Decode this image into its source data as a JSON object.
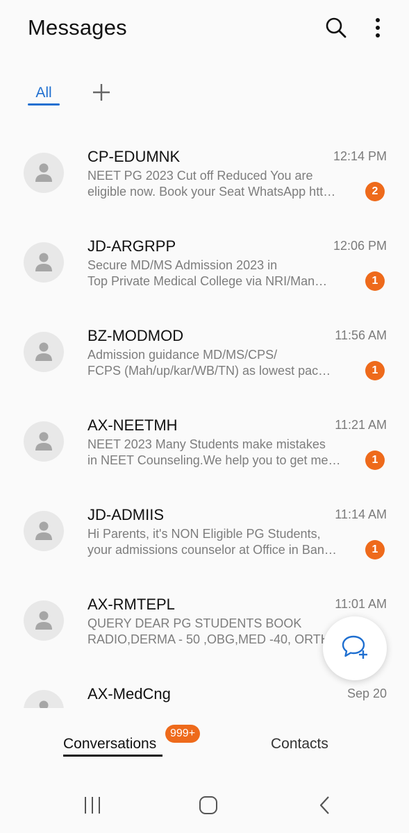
{
  "header": {
    "title": "Messages",
    "search_icon": "search-icon",
    "more_icon": "more-vertical-icon"
  },
  "tabs": {
    "all_label": "All",
    "add_icon": "plus-icon"
  },
  "conversations": [
    {
      "sender": "CP-EDUMNK",
      "time": "12:14 PM",
      "preview_line1": "NEET PG 2023 Cut off Reduced You are",
      "preview_line2": "eligible now. Book your Seat  WhatsApp htt…",
      "unread": "2"
    },
    {
      "sender": "JD-ARGRPP",
      "time": "12:06 PM",
      "preview_line1": "Secure MD/MS Admission 2023 in",
      "preview_line2": "Top Private  Medical College via NRI/Man…",
      "unread": "1"
    },
    {
      "sender": "BZ-MODMOD",
      "time": "11:56 AM",
      "preview_line1": "Admission guidance MD/MS/CPS/",
      "preview_line2": "FCPS (Mah/up/kar/WB/TN) as lowest pac…",
      "unread": "1"
    },
    {
      "sender": "AX-NEETMH",
      "time": "11:21 AM",
      "preview_line1": "NEET 2023 Many Students make mistakes",
      "preview_line2": "in NEET Counseling.We help you to get me…",
      "unread": "1"
    },
    {
      "sender": "JD-ADMIIS",
      "time": "11:14 AM",
      "preview_line1": "Hi Parents, it's NON Eligible PG Students,",
      "preview_line2": "your admissions counselor at Office in Ban…",
      "unread": "1"
    },
    {
      "sender": "AX-RMTEPL",
      "time": "11:01 AM",
      "preview_line1": "QUERY DEAR  PG STUDENTS BOOK",
      "preview_line2": "RADIO,DERMA - 50 ,OBG,MED -40, ORTH…",
      "unread": ""
    },
    {
      "sender": "AX-MedCng",
      "time": "Sep 20",
      "preview_line1": "",
      "preview_line2": "",
      "unread": ""
    }
  ],
  "fab": {
    "icon": "new-chat-icon"
  },
  "bottom_tabs": {
    "conversations_label": "Conversations",
    "conversations_badge": "999+",
    "contacts_label": "Contacts"
  },
  "nav": {
    "recents_icon": "recents-icon",
    "home_icon": "home-icon",
    "back_icon": "back-icon"
  },
  "colors": {
    "accent": "#1f6fd0",
    "badge": "#ee6a1b",
    "background": "#fafafa"
  }
}
